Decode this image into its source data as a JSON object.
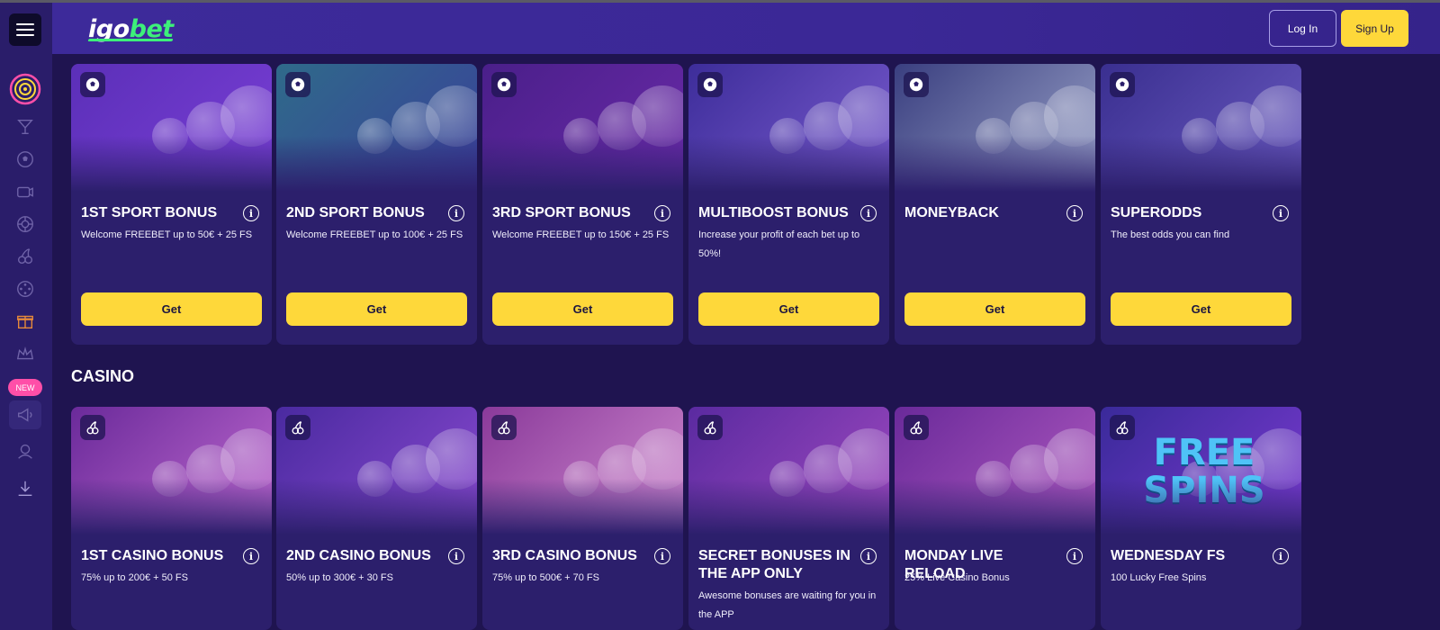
{
  "header": {
    "logo_part1": "igo",
    "logo_part2": "bet",
    "login_label": "Log In",
    "signup_label": "Sign Up"
  },
  "sidebar": {
    "new_badge": "NEW",
    "icons": [
      "target-icon",
      "cocktail-icon",
      "soccer-ball-icon",
      "tv-icon",
      "roulette-icon",
      "cherries-icon",
      "reel-icon",
      "gift-icon",
      "crown-icon",
      "megaphone-icon",
      "support-agent-icon",
      "download-icon"
    ]
  },
  "sport_cards": [
    {
      "title": "1ST SPORT BONUS",
      "desc": "Welcome FREEBET up to 50€ + 25 FS",
      "button": "Get",
      "bg1": "#5b2fb8",
      "bg2": "#7a3fd6"
    },
    {
      "title": "2ND SPORT BONUS",
      "desc": "Welcome FREEBET up to 100€ + 25 FS",
      "button": "Get",
      "bg1": "#2f6a8a",
      "bg2": "#3a3f9a"
    },
    {
      "title": "3RD SPORT BONUS",
      "desc": "Welcome FREEBET up to 150€ + 25 FS",
      "button": "Get",
      "bg1": "#4a1f8a",
      "bg2": "#6a2aa8"
    },
    {
      "title": "MULTIBOOST BONUS",
      "desc": "Increase your profit of each bet up to 50%!",
      "button": "Get",
      "bg1": "#3d2d9a",
      "bg2": "#7a5ccf"
    },
    {
      "title": "MONEYBACK",
      "desc": "",
      "button": "Get",
      "bg1": "#3a3f80",
      "bg2": "#9aa2c8"
    },
    {
      "title": "SUPERODDS",
      "desc": "The best odds you can find",
      "button": "Get",
      "bg1": "#3a2f90",
      "bg2": "#6a5ac0"
    }
  ],
  "casino_section": {
    "title": "CASINO"
  },
  "casino_cards": [
    {
      "title": "1ST CASINO BONUS",
      "desc": "75% up to 200€ + 50 FS",
      "bg1": "#6a2a9a",
      "bg2": "#c06ad0"
    },
    {
      "title": "2ND CASINO BONUS",
      "desc": "50% up to 300€ + 30 FS",
      "bg1": "#4a2aa0",
      "bg2": "#8a4ad0"
    },
    {
      "title": "3RD CASINO BONUS",
      "desc": "75% up to 500€ + 70 FS",
      "bg1": "#8a3a9a",
      "bg2": "#d08ad0"
    },
    {
      "title": "SECRET BONUSES IN THE APP ONLY",
      "desc": "Awesome bonuses are waiting for you in the APP",
      "bg1": "#5a2aa0",
      "bg2": "#a04ac0"
    },
    {
      "title": "MONDAY LIVE RELOAD",
      "desc": "25% Live Casino Bonus",
      "bg1": "#6a2a9a",
      "bg2": "#b05ac0"
    },
    {
      "title": "WEDNESDAY FS",
      "desc": "100 Lucky Free Spins",
      "bg1": "#3a2a9a",
      "bg2": "#7a3ad0",
      "art_text": "FREE SPINS"
    }
  ],
  "colors": {
    "accent_yellow": "#fed83a",
    "logo_green": "#3df07a",
    "card_bg": "#2c1f6c",
    "page_bg": "#1f1450",
    "badge_pink": "#ff4fa8"
  }
}
